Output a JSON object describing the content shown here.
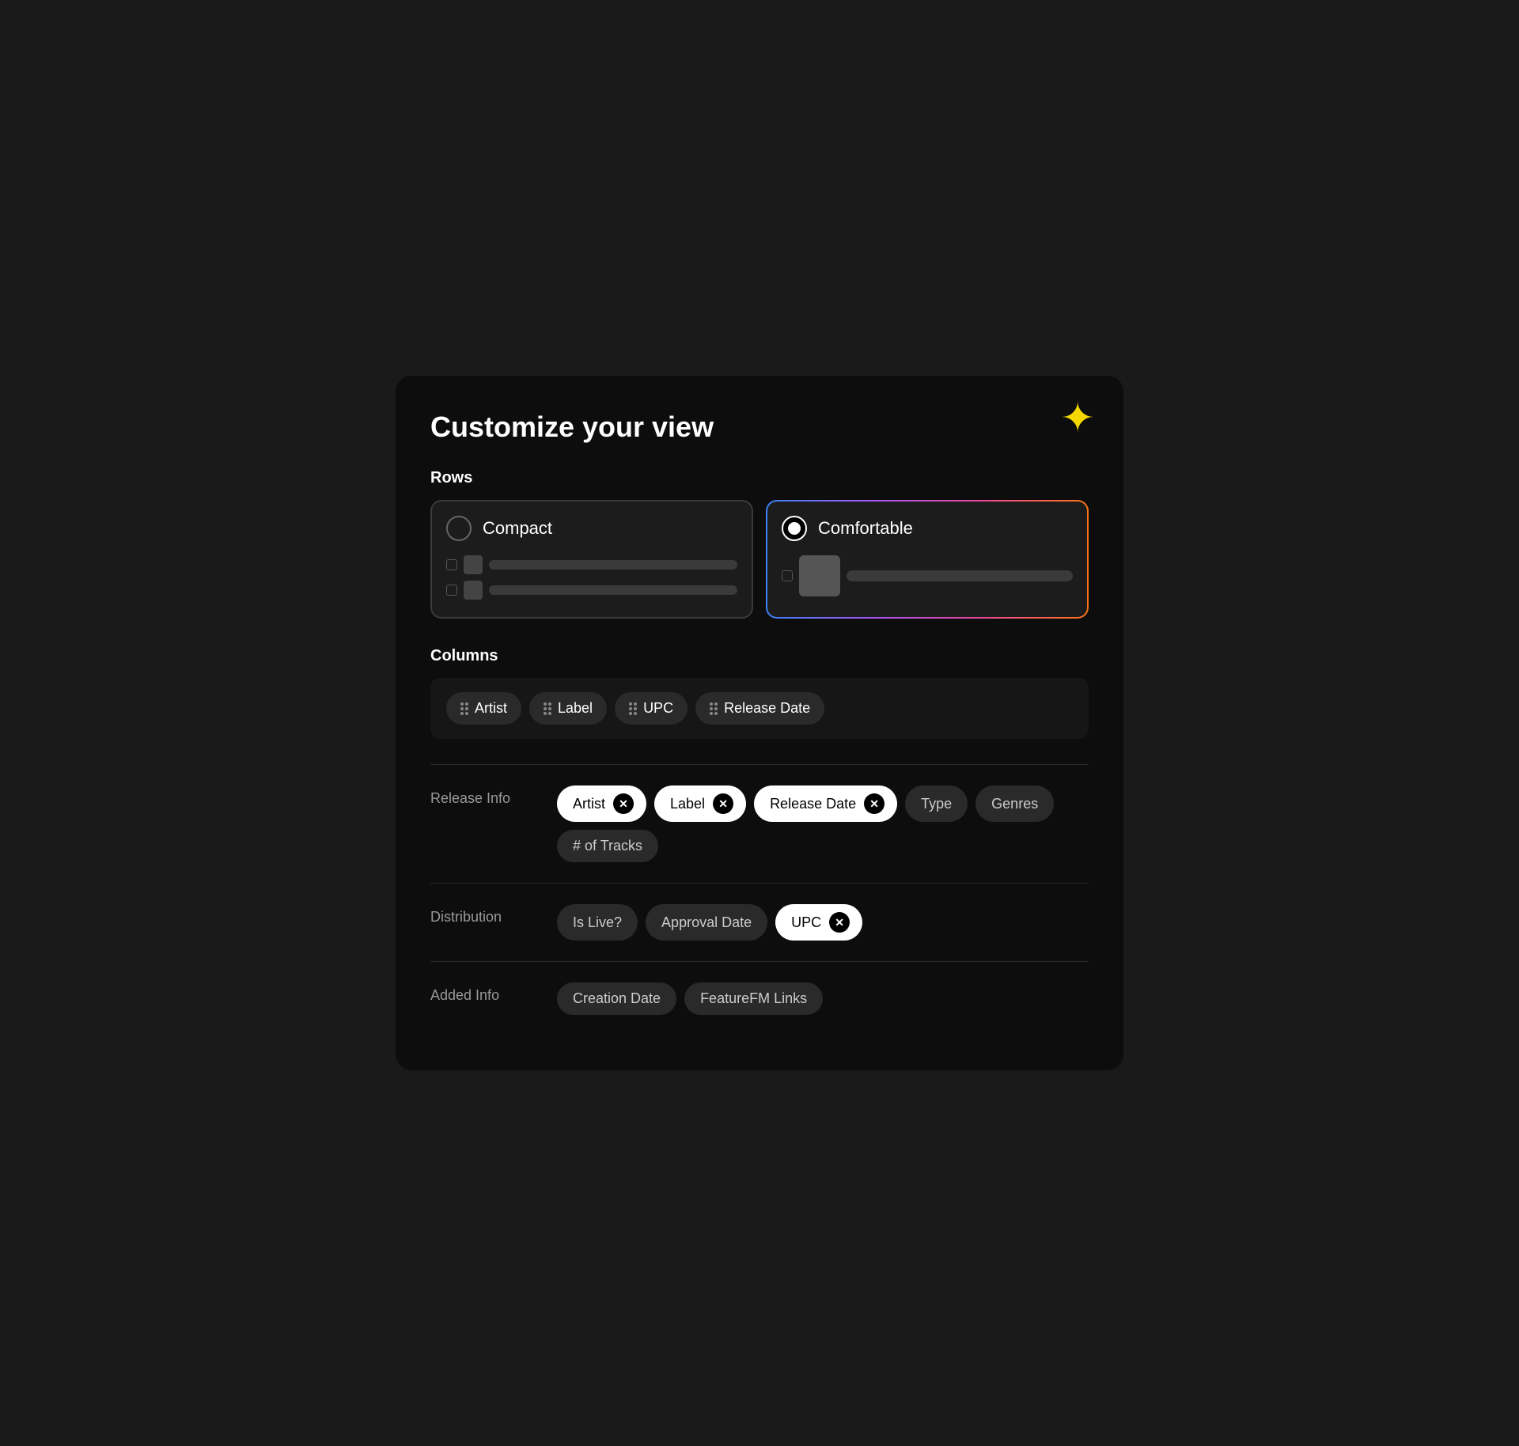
{
  "modal": {
    "title": "Customize your view"
  },
  "rows": {
    "label": "Rows",
    "options": [
      {
        "id": "compact",
        "label": "Compact",
        "selected": false
      },
      {
        "id": "comfortable",
        "label": "Comfortable",
        "selected": true
      }
    ]
  },
  "columns": {
    "label": "Columns",
    "items": [
      {
        "label": "Artist"
      },
      {
        "label": "Label"
      },
      {
        "label": "UPC"
      },
      {
        "label": "Release Date"
      }
    ]
  },
  "sections": [
    {
      "id": "release-info",
      "label": "Release Info",
      "active_chips": [
        {
          "label": "Artist"
        },
        {
          "label": "Label"
        },
        {
          "label": "Release Date"
        }
      ],
      "inactive_chips": [
        {
          "label": "Type"
        },
        {
          "label": "Genres"
        },
        {
          "label": "# of Tracks"
        }
      ]
    },
    {
      "id": "distribution",
      "label": "Distribution",
      "active_chips": [
        {
          "label": "UPC"
        }
      ],
      "inactive_chips": [
        {
          "label": "Is Live?"
        },
        {
          "label": "Approval Date"
        }
      ]
    },
    {
      "id": "added-info",
      "label": "Added Info",
      "active_chips": [],
      "inactive_chips": [
        {
          "label": "Creation Date"
        },
        {
          "label": "FeatureFM Links"
        }
      ]
    }
  ],
  "icons": {
    "star": "✦",
    "close": "✕",
    "drag": "⠿"
  }
}
